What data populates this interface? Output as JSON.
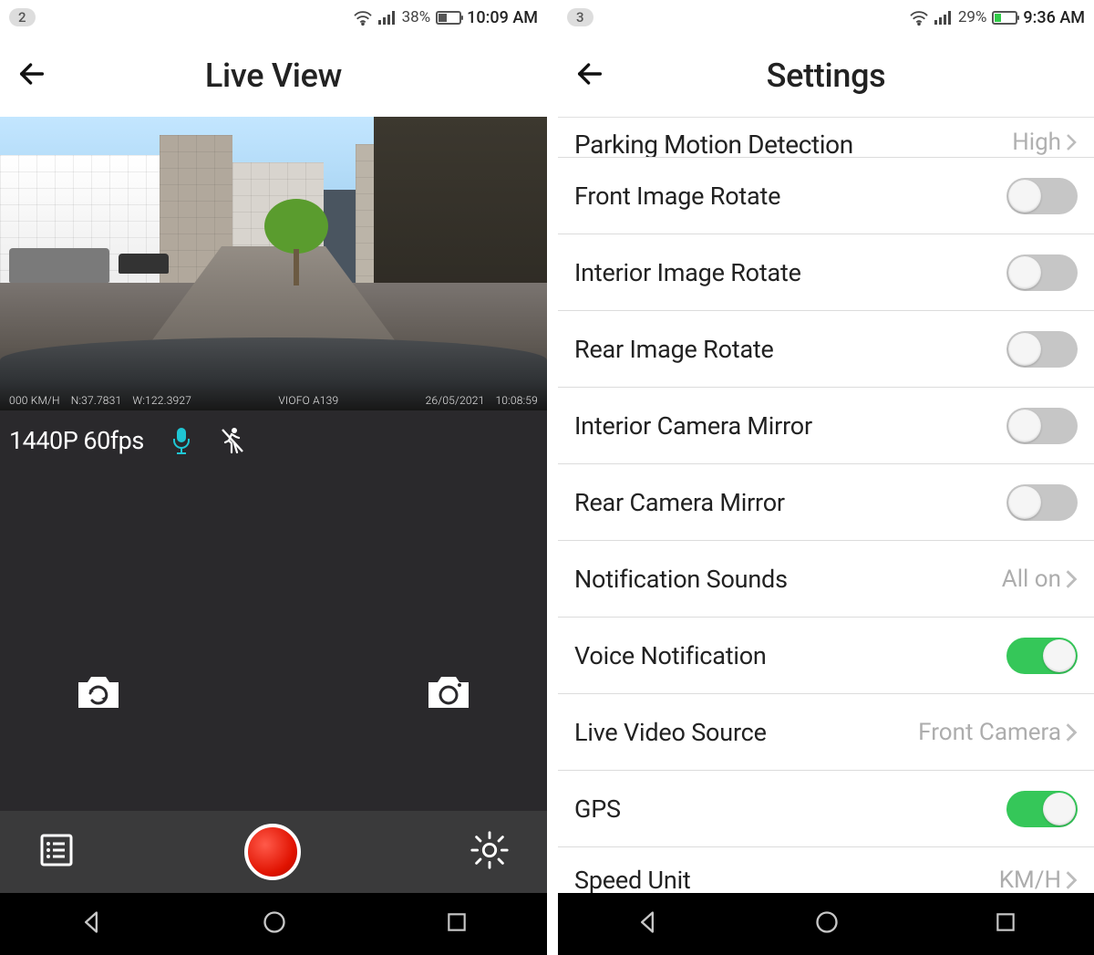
{
  "left": {
    "status": {
      "badge": "2",
      "battery_pct": "38%",
      "battery_fill_pct": 38,
      "clock": "10:09 AM"
    },
    "title": "Live View",
    "video_overlay": {
      "speed": "000 KM/H",
      "lat": "N:37.7831",
      "lon": "W:122.3927",
      "model": "VIOFO A139",
      "date": "26/05/2021",
      "time": "10:08:59"
    },
    "info": {
      "resolution": "1440P 60fps"
    }
  },
  "right": {
    "status": {
      "badge": "3",
      "battery_pct": "29%",
      "battery_fill_pct": 29,
      "clock": "9:36 AM"
    },
    "title": "Settings",
    "partial": {
      "label": "Parking Motion Detection",
      "value": "High"
    },
    "rows": [
      {
        "label": "Front Image Rotate",
        "kind": "toggle",
        "on": false
      },
      {
        "label": "Interior Image Rotate",
        "kind": "toggle",
        "on": false
      },
      {
        "label": "Rear Image Rotate",
        "kind": "toggle",
        "on": false
      },
      {
        "label": "Interior Camera Mirror",
        "kind": "toggle",
        "on": false
      },
      {
        "label": "Rear Camera Mirror",
        "kind": "toggle",
        "on": false
      },
      {
        "label": "Notification Sounds",
        "kind": "link",
        "value": "All on"
      },
      {
        "label": "Voice Notification",
        "kind": "toggle",
        "on": true
      },
      {
        "label": "Live Video Source",
        "kind": "link",
        "value": "Front Camera"
      },
      {
        "label": "GPS",
        "kind": "toggle",
        "on": true
      },
      {
        "label": "Speed Unit",
        "kind": "link",
        "value": "KM/H"
      }
    ]
  }
}
